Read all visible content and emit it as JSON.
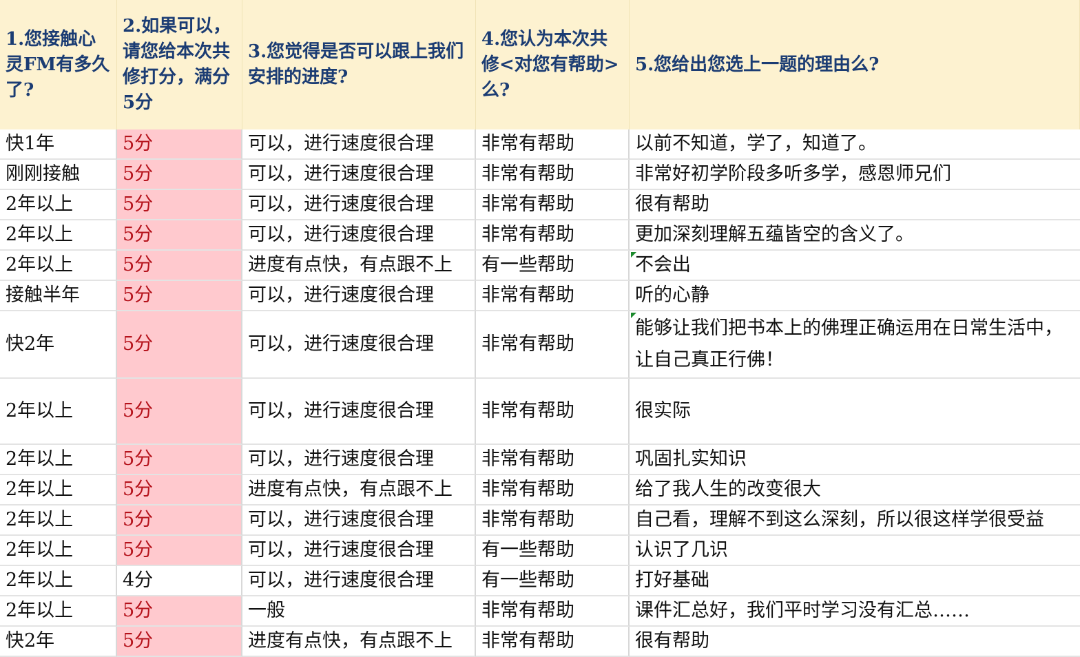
{
  "headers": [
    "1.您接触心灵FM有多久了?",
    "2.如果可以，请您给本次共修打分，满分5分",
    "3.您觉得是否可以跟上我们安排的进度?",
    "4.您认为本次共修<对您有帮助>么?",
    "5.您给出您选上一题的理由么?"
  ],
  "rows": [
    {
      "c1": "快1年",
      "c2": "5分",
      "c3": "可以，进行速度很合理",
      "c4": "非常有帮助",
      "c5": "以前不知道，学了，知道了。",
      "highlight": true
    },
    {
      "c1": "刚刚接触",
      "c2": "5分",
      "c3": "可以，进行速度很合理",
      "c4": "非常有帮助",
      "c5": "非常好初学阶段多听多学，感恩师兄们",
      "highlight": true
    },
    {
      "c1": "2年以上",
      "c2": "5分",
      "c3": "可以，进行速度很合理",
      "c4": "非常有帮助",
      "c5": "很有帮助",
      "highlight": true
    },
    {
      "c1": "2年以上",
      "c2": "5分",
      "c3": "可以，进行速度很合理",
      "c4": "非常有帮助",
      "c5": "更加深刻理解五蕴皆空的含义了。",
      "highlight": true
    },
    {
      "c1": "2年以上",
      "c2": "5分",
      "c3": "进度有点快，有点跟不上",
      "c4": "有一些帮助",
      "c5": "不会出",
      "highlight": true
    },
    {
      "c1": "接触半年",
      "c2": "5分",
      "c3": "可以，进行速度很合理",
      "c4": "非常有帮助",
      "c5": "听的心静",
      "highlight": true
    },
    {
      "c1": "快2年",
      "c2": "5分",
      "c3": "可以，进行速度很合理",
      "c4": "非常有帮助",
      "c5": "能够让我们把书本上的佛理正确运用在日常生活中，让自己真正行佛！",
      "highlight": true
    },
    {
      "c1": "2年以上",
      "c2": "5分",
      "c3": "可以，进行速度很合理",
      "c4": "非常有帮助",
      "c5": "很实际",
      "highlight": true
    },
    {
      "c1": "2年以上",
      "c2": "5分",
      "c3": "可以，进行速度很合理",
      "c4": "非常有帮助",
      "c5": "巩固扎实知识",
      "highlight": true
    },
    {
      "c1": "2年以上",
      "c2": "5分",
      "c3": "进度有点快，有点跟不上",
      "c4": "非常有帮助",
      "c5": "给了我人生的改变很大",
      "highlight": true
    },
    {
      "c1": "2年以上",
      "c2": "5分",
      "c3": "可以，进行速度很合理",
      "c4": "非常有帮助",
      "c5": "自己看，理解不到这么深刻，所以很这样学很受益",
      "highlight": true
    },
    {
      "c1": "2年以上",
      "c2": "5分",
      "c3": "可以，进行速度很合理",
      "c4": "有一些帮助",
      "c5": "认识了几识",
      "highlight": true
    },
    {
      "c1": "2年以上",
      "c2": "4分",
      "c3": "可以，进行速度很合理",
      "c4": "有一些帮助",
      "c5": "打好基础",
      "highlight": false
    },
    {
      "c1": "2年以上",
      "c2": "5分",
      "c3": "一般",
      "c4": "非常有帮助",
      "c5": "课件汇总好，我们平时学习没有汇总……",
      "highlight": true
    },
    {
      "c1": "快2年",
      "c2": "5分",
      "c3": "进度有点快，有点跟不上",
      "c4": "非常有帮助",
      "c5": "很有帮助",
      "highlight": true
    }
  ],
  "colors": {
    "header_bg": "#fdf2d0",
    "header_text": "#1b3c73",
    "score_highlight_bg": "#ffc9ce",
    "score_highlight_text": "#b5121b"
  }
}
